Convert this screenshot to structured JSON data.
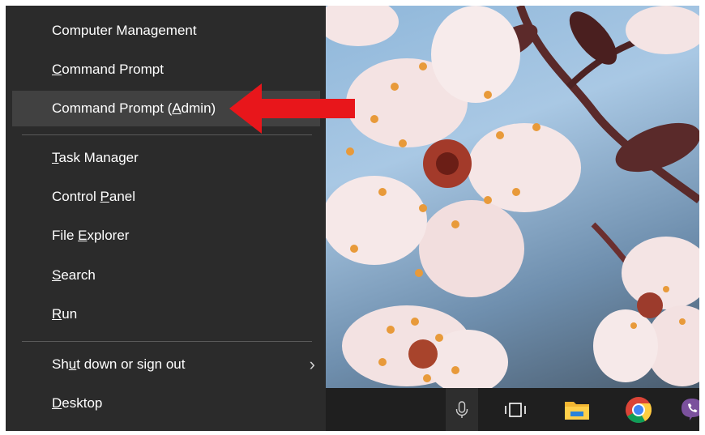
{
  "menu": {
    "items": [
      {
        "pre": "Computer Management",
        "acc": "",
        "post": ""
      },
      {
        "pre": "",
        "acc": "C",
        "post": "ommand Prompt"
      },
      {
        "pre": "Command Prompt (",
        "acc": "A",
        "post": "dmin)"
      },
      {
        "pre": "",
        "acc": "T",
        "post": "ask Manager"
      },
      {
        "pre": "Control ",
        "acc": "P",
        "post": "anel"
      },
      {
        "pre": "File ",
        "acc": "E",
        "post": "xplorer"
      },
      {
        "pre": "",
        "acc": "S",
        "post": "earch"
      },
      {
        "pre": "",
        "acc": "R",
        "post": "un"
      },
      {
        "pre": "Sh",
        "acc": "u",
        "post": "t down or sign out"
      },
      {
        "pre": "",
        "acc": "D",
        "post": "esktop"
      }
    ],
    "highlighted_index": 2,
    "submenu_icon": "chevron-right-icon"
  },
  "taskbar": {
    "icons": [
      "microphone-icon",
      "task-view-icon",
      "file-explorer-icon",
      "chrome-icon",
      "viber-icon"
    ]
  },
  "colors": {
    "menu_bg": "#2b2b2b",
    "menu_hover": "#414141",
    "taskbar_bg": "#1f1f1f",
    "arrow": "#e8161b"
  }
}
